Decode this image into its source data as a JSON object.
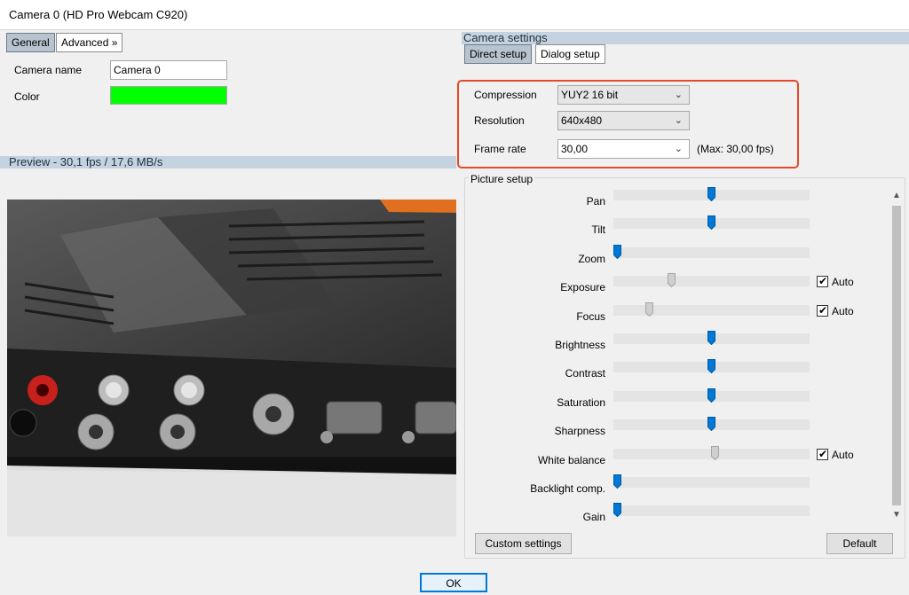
{
  "window": {
    "title": "Camera 0 (HD Pro Webcam C920)"
  },
  "left_tabs": {
    "general": "General",
    "advanced": "Advanced »"
  },
  "camera": {
    "name_label": "Camera name",
    "name_value": "Camera 0",
    "color_label": "Color",
    "color_value": "#00ff00"
  },
  "preview": {
    "header": "Preview  -  30,1 fps / 17,6 MB/s"
  },
  "camera_settings": {
    "header": "Camera settings",
    "tabs": {
      "direct": "Direct setup",
      "dialog": "Dialog setup"
    },
    "compression_label": "Compression",
    "compression_value": "YUY2 16 bit",
    "resolution_label": "Resolution",
    "resolution_value": "640x480",
    "framerate_label": "Frame rate",
    "framerate_value": "30,00",
    "framerate_max": "(Max: 30,00 fps)"
  },
  "picture_setup": {
    "title": "Picture setup",
    "auto_label": "Auto",
    "sliders": [
      {
        "name": "pan",
        "label": "Pan",
        "value": 0.5,
        "thumb": "blue",
        "auto": null
      },
      {
        "name": "tilt",
        "label": "Tilt",
        "value": 0.5,
        "thumb": "blue",
        "auto": null
      },
      {
        "name": "zoom",
        "label": "Zoom",
        "value": 0.0,
        "thumb": "blue",
        "auto": null
      },
      {
        "name": "exposure",
        "label": "Exposure",
        "value": 0.29,
        "thumb": "grey",
        "auto": true
      },
      {
        "name": "focus",
        "label": "Focus",
        "value": 0.17,
        "thumb": "grey",
        "auto": true
      },
      {
        "name": "brightness",
        "label": "Brightness",
        "value": 0.5,
        "thumb": "blue",
        "auto": null
      },
      {
        "name": "contrast",
        "label": "Contrast",
        "value": 0.5,
        "thumb": "blue",
        "auto": null
      },
      {
        "name": "saturation",
        "label": "Saturation",
        "value": 0.5,
        "thumb": "blue",
        "auto": null
      },
      {
        "name": "sharpness",
        "label": "Sharpness",
        "value": 0.5,
        "thumb": "blue",
        "auto": null
      },
      {
        "name": "white-balance",
        "label": "White balance",
        "value": 0.52,
        "thumb": "grey",
        "auto": true
      },
      {
        "name": "backlight-comp",
        "label": "Backlight comp.",
        "value": 0.0,
        "thumb": "blue",
        "auto": null
      },
      {
        "name": "gain",
        "label": "Gain",
        "value": 0.0,
        "thumb": "blue",
        "auto": null
      }
    ],
    "custom_settings": "Custom settings",
    "default": "Default"
  },
  "footer": {
    "ok": "OK"
  },
  "colors": {
    "accent": "#0078d7",
    "highlight_border": "#e34a2a",
    "header_bar": "#c4d3df"
  }
}
